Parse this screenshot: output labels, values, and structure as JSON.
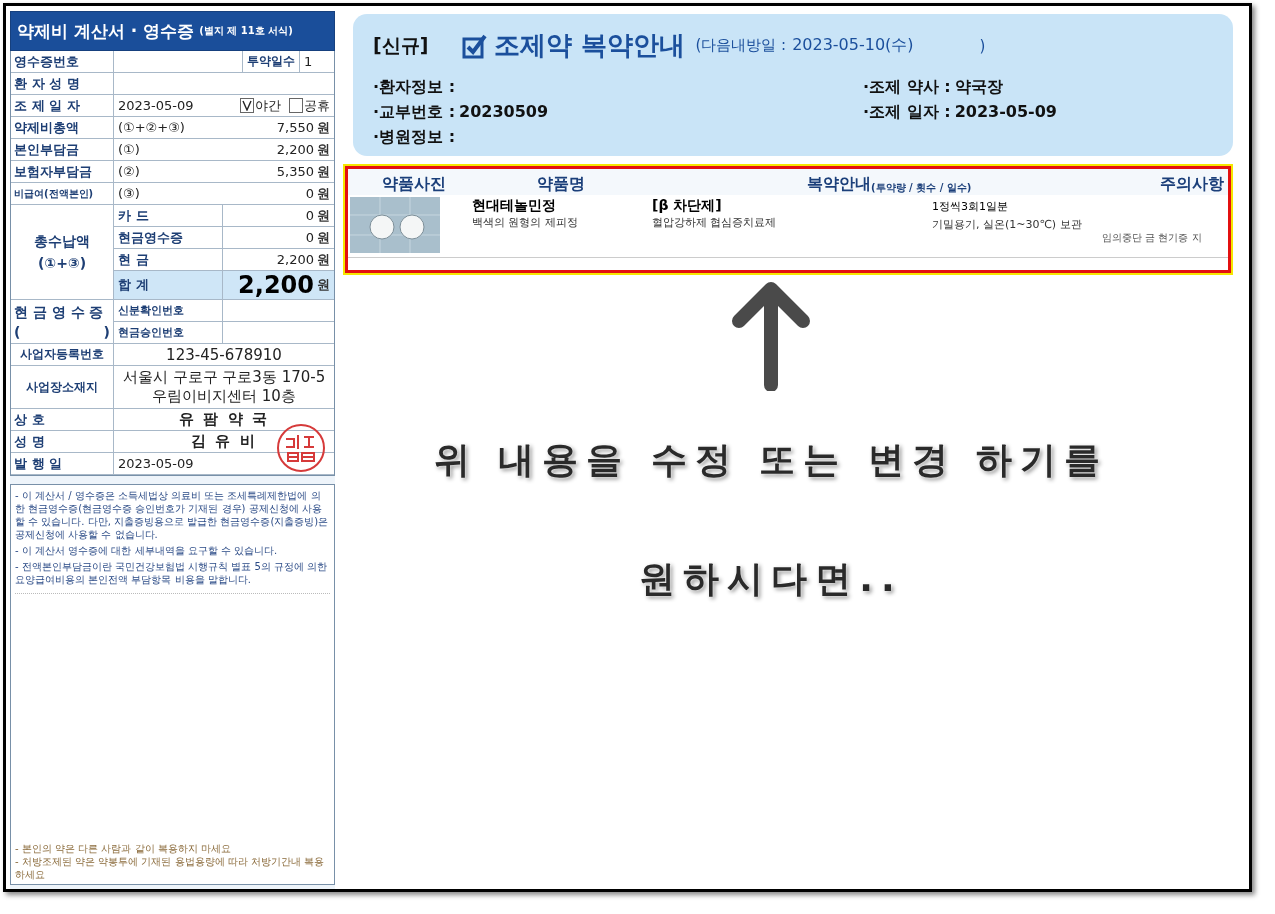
{
  "receipt": {
    "title": "약제비 계산서 · 영수증",
    "form_note": "(별지 제 11호 서식)",
    "receipt_no_label": "영수증번호",
    "days_label": "투약일수",
    "days_value": "1",
    "patient_label": "환 자 성 명",
    "date_label": "조 제 일 자",
    "date_value": "2023-05-09",
    "options": [
      {
        "label": "야간",
        "checked": true
      },
      {
        "label": "공휴",
        "checked": false
      }
    ],
    "amounts": [
      {
        "label": "약제비총액",
        "formula": "(①+②+③)",
        "value": "7,550",
        "unit": "원"
      },
      {
        "label": "본인부담금",
        "formula": "(①)",
        "value": "2,200",
        "unit": "원"
      },
      {
        "label": "보험자부담금",
        "formula": "(②)",
        "value": "5,350",
        "unit": "원"
      },
      {
        "label": "비급여(전액본인)",
        "formula": "(③)",
        "value": "0",
        "unit": "원"
      }
    ],
    "total": {
      "label": "총수납액",
      "formula": "(①+③)",
      "items": [
        {
          "kind": "item",
          "label": "카 드",
          "value": "0",
          "unit": "원"
        },
        {
          "kind": "item",
          "label": "현금영수증",
          "value": "0",
          "unit": "원"
        },
        {
          "kind": "item",
          "label": "현 금",
          "value": "2,200",
          "unit": "원"
        },
        {
          "kind": "total",
          "label": "합 계",
          "value": "2,200",
          "unit": "원"
        }
      ]
    },
    "cash_receipt": {
      "label": "현 금 영 수 증",
      "paren_open": "(",
      "paren_close": ")",
      "items": [
        "신분확인번호",
        "현금승인번호"
      ]
    },
    "business_no": {
      "label": "사업자등록번호",
      "value": "123-45-678910"
    },
    "address": {
      "label": "사업장소재지",
      "lines": [
        "서울시 구로구 구로3동 170-5",
        "우림이비지센터 10층"
      ]
    },
    "info_rows": [
      {
        "label": "상 호",
        "value": "유 팜 약 국",
        "kind": "name"
      },
      {
        "label": "성 명",
        "value": "김 유 비",
        "kind": "name"
      },
      {
        "label": "발 행 일",
        "value": "2023-05-09",
        "kind": "date"
      }
    ],
    "notes": [
      "- 이 계산서 / 영수증은 소득세법상 의료비 또는 조세특례제한법에 의한 현금영수증(현금영수증 승인번호가 기재된 경우) 공제신청에 사용할 수 있습니다. 다만, 지출증빙용으로 발급한 현금영수증(지출증빙)은 공제신청에 사용할 수 없습니다.",
      "- 이 계산서 영수증에 대한 세부내역을 요구할 수 있습니다.",
      "- 전액본인부담금이란 국민건강보험법 시행규칙 별표 5의 규정에 의한 요양급여비용의 본인전액 부담항목 비용을 말합니다."
    ],
    "footer_notes": [
      "- 본인의 약은 다른 사람과 같이 복용하지 마세요",
      "- 처방조제된 약은 약봉투에 기재된 용법용량에 따라 처방기간내 복용하세요"
    ]
  },
  "guide": {
    "tag": "[신규]",
    "title": "조제약 복약안내",
    "next_visit_label": "(다음내방일 :",
    "next_visit_value": "2023-05-10(수)",
    "close_paren": ")",
    "left_info": [
      {
        "label": "·환자정보 :"
      },
      {
        "label": "·교부번호 :",
        "value": "20230509"
      },
      {
        "label": "·병원정보 :"
      }
    ],
    "right_info": [
      {
        "label": "·조제 약사 :",
        "value": "약국장"
      },
      {
        "label": "·조제 일자 :",
        "value": "2023-05-09"
      }
    ]
  },
  "drug_table": {
    "columns": [
      {
        "label": "약품사진"
      },
      {
        "label": "약품명"
      },
      {
        "label": "복약안내",
        "note": "(투약량 / 횟수 / 일수)"
      },
      {
        "label": "주의사항"
      }
    ],
    "rows": [
      {
        "name": "현대테놀민정",
        "description": "백색의 원형의 제피정",
        "class": "[β 차단제]",
        "effect": "혈압강하제 협심증치료제",
        "dosage": "1정씩3회1일분",
        "storage": "기밀용기, 실온(1~30℃) 보관",
        "caution": "임의중단 금 현기증 지"
      }
    ]
  },
  "annotation": {
    "lines": [
      "위 내용을 수정 또는 변경 하기를",
      "원하시다면.."
    ]
  }
}
